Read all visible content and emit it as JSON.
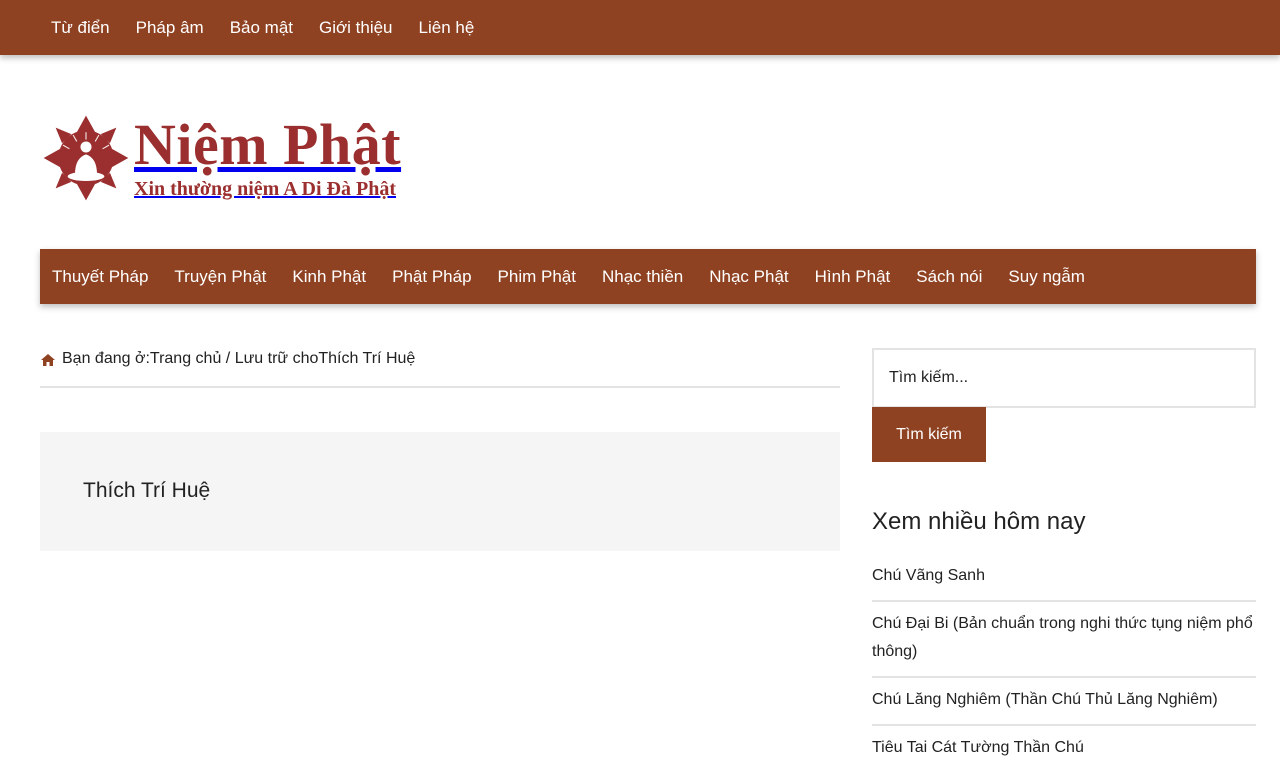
{
  "topnav": {
    "items": [
      {
        "label": "Từ điển"
      },
      {
        "label": "Pháp âm"
      },
      {
        "label": "Bảo mật"
      },
      {
        "label": "Giới thiệu"
      },
      {
        "label": "Liên hệ"
      }
    ]
  },
  "logo": {
    "title": "Niệm Phật",
    "subtitle": "Xin thường niệm A Di Đà Phật",
    "icon": "buddha-lotus-icon",
    "color": "#9b2e2e"
  },
  "mainnav": {
    "items": [
      {
        "label": "Thuyết Pháp"
      },
      {
        "label": "Truyện Phật"
      },
      {
        "label": "Kinh Phật"
      },
      {
        "label": "Phật Pháp"
      },
      {
        "label": "Phim Phật"
      },
      {
        "label": "Nhạc thiền"
      },
      {
        "label": "Nhạc Phật"
      },
      {
        "label": "Hình Phật"
      },
      {
        "label": "Sách nói"
      },
      {
        "label": "Suy ngẫm"
      }
    ]
  },
  "breadcrumb": {
    "icon": "home-icon",
    "prefix": "Bạn đang ở:",
    "home": "Trang chủ",
    "separator": " / ",
    "archive_prefix": "Lưu trữ cho",
    "current": "Thích Trí Huệ"
  },
  "archive": {
    "title": "Thích Trí Huệ"
  },
  "search": {
    "placeholder": "Tìm kiếm...",
    "button_label": "Tìm kiếm"
  },
  "popular": {
    "title": "Xem nhiều hôm nay",
    "items": [
      {
        "label": "Chú Vãng Sanh"
      },
      {
        "label": "Chú Đại Bi (Bản chuẩn trong nghi thức tụng niệm phổ thông)"
      },
      {
        "label": "Chú Lăng Nghiêm (Thần Chú Thủ Lăng Nghiêm)"
      },
      {
        "label": "Tiêu Tai Cát Tường Thần Chú"
      }
    ]
  },
  "colors": {
    "brand": "#8f4222",
    "logo": "#9b2e2e",
    "panel": "#f5f5f5",
    "border": "#e3e3e3"
  }
}
